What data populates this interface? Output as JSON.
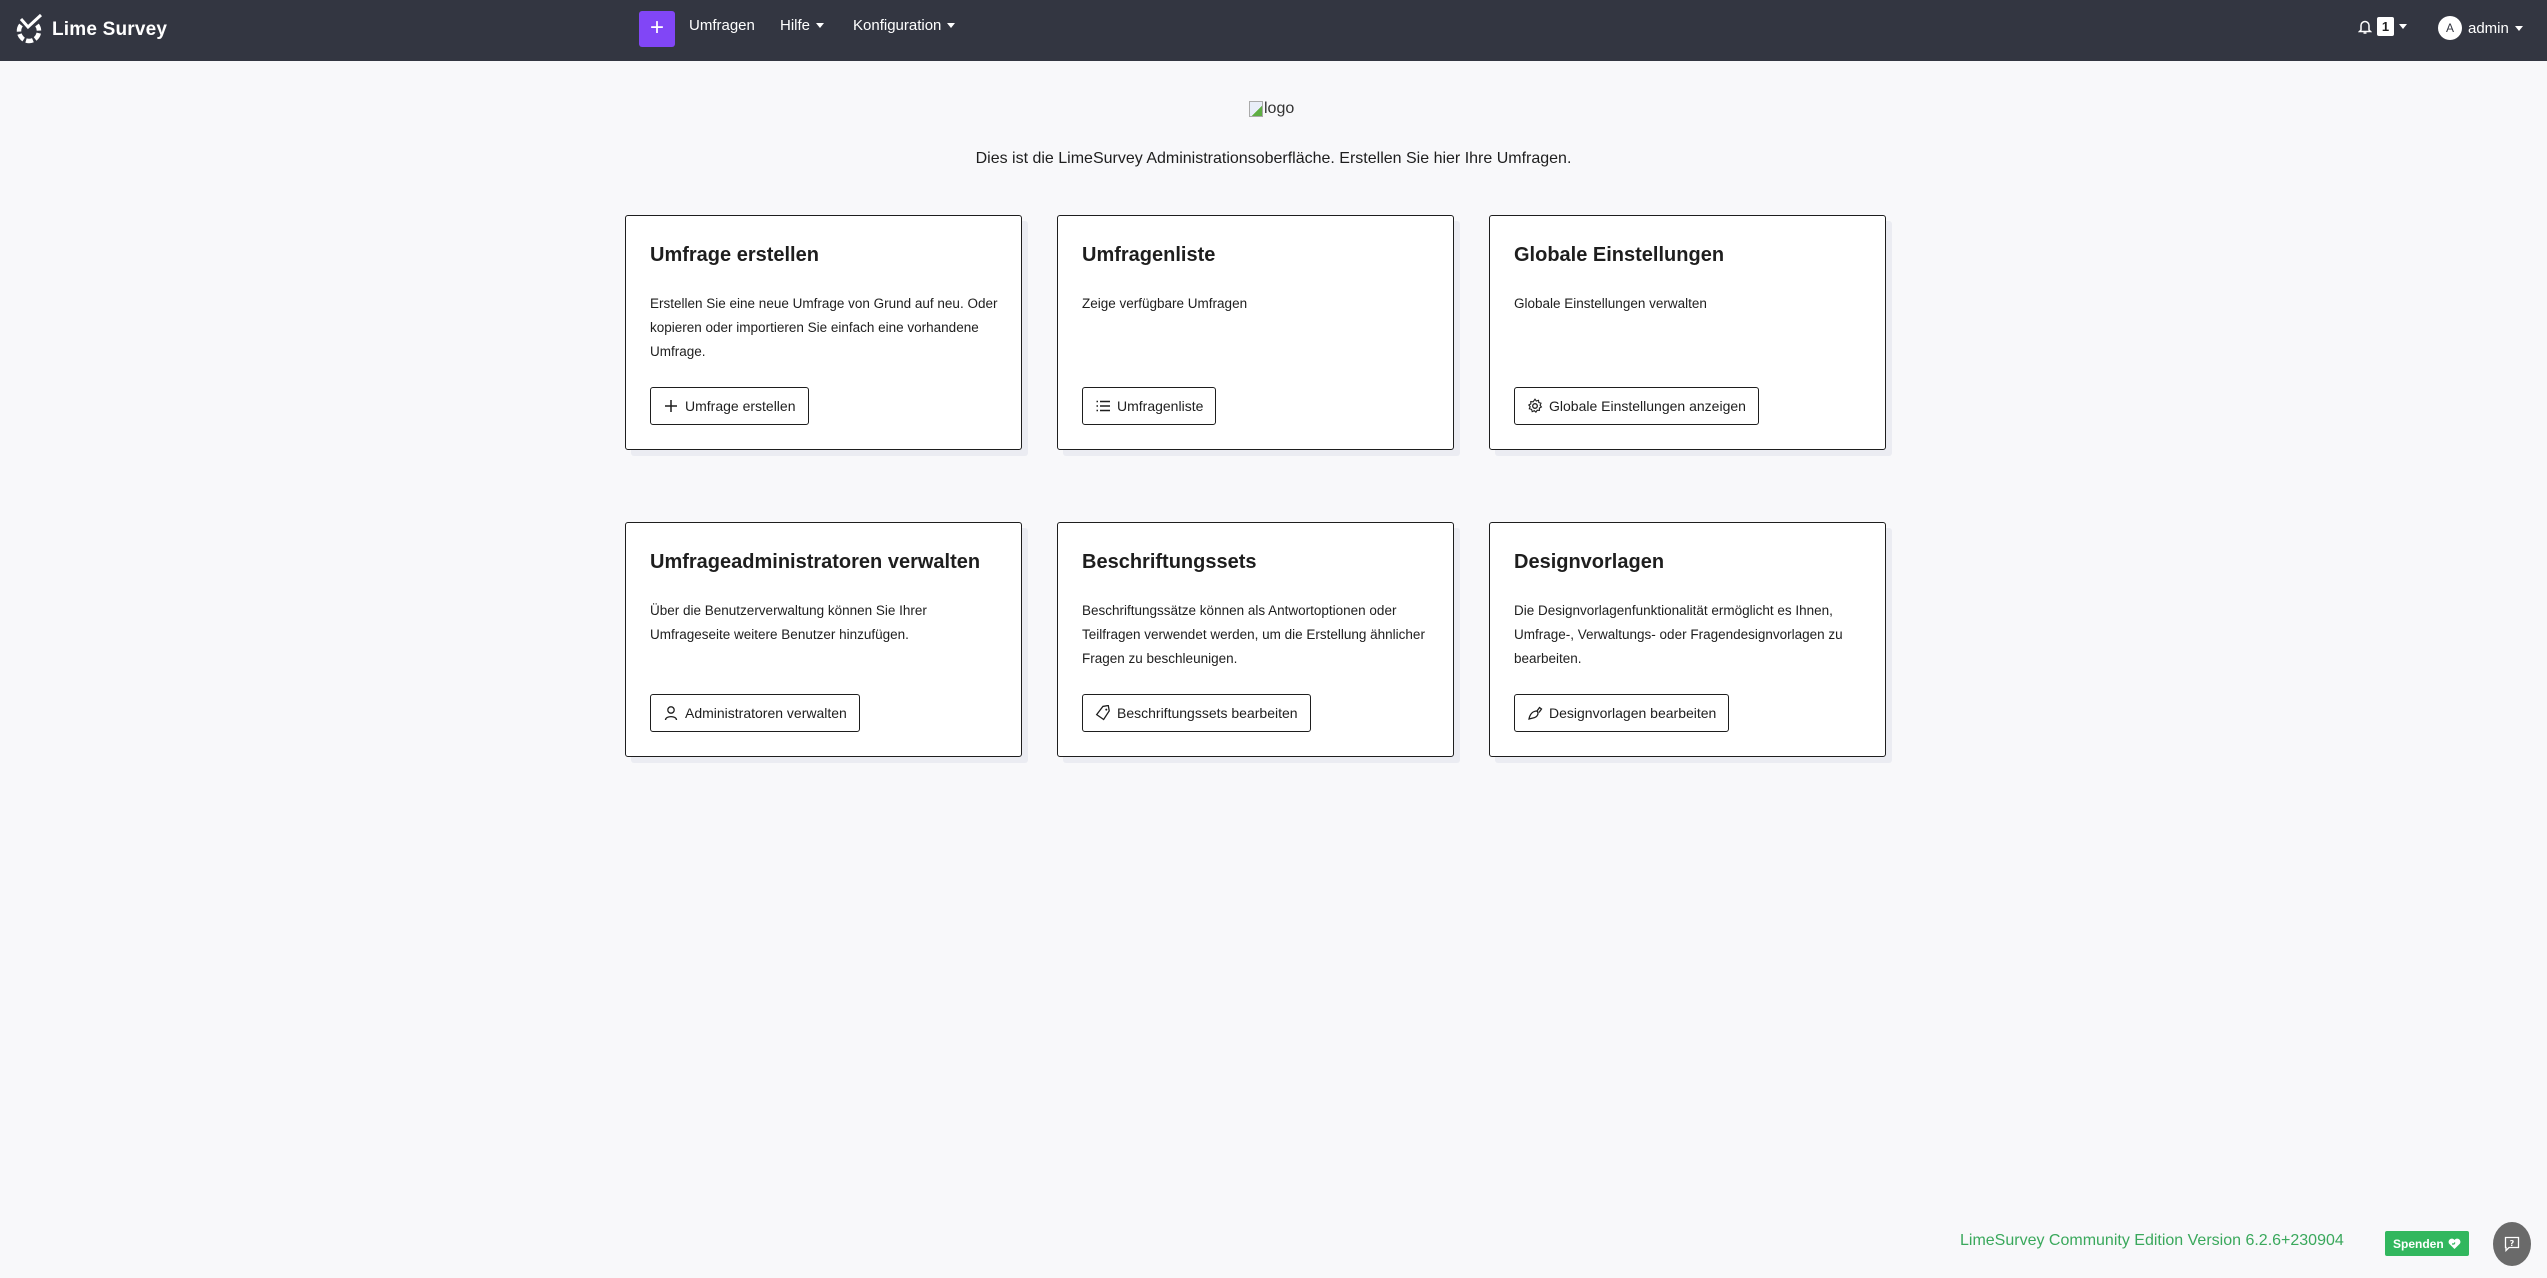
{
  "navbar": {
    "brand": "Lime Survey",
    "plus_label": "+",
    "items": [
      {
        "label": "Umfragen",
        "has_caret": false
      },
      {
        "label": "Hilfe",
        "has_caret": true
      },
      {
        "label": "Konfiguration",
        "has_caret": true
      }
    ],
    "notification_count": "1",
    "user": {
      "avatar_letter": "A",
      "name": "admin"
    }
  },
  "hero": {
    "logo_alt": "logo",
    "intro": "Dies ist die LimeSurvey Administrationsoberfläche. Erstellen Sie hier Ihre Umfragen."
  },
  "cards": [
    {
      "title": "Umfrage erstellen",
      "description": "Erstellen Sie eine neue Umfrage von Grund auf neu. Oder kopieren oder importieren Sie einfach eine vorhandene Umfrage.",
      "button_label": "Umfrage erstellen",
      "icon": "plus-icon"
    },
    {
      "title": "Umfragenliste",
      "description": "Zeige verfügbare Umfragen",
      "button_label": "Umfragenliste",
      "icon": "list-icon"
    },
    {
      "title": "Globale Einstellungen",
      "description": "Globale Einstellungen verwalten",
      "button_label": "Globale Einstellungen anzeigen",
      "icon": "gear-icon"
    },
    {
      "title": "Umfrageadministratoren verwalten",
      "description": "Über die Benutzerverwaltung können Sie Ihrer Umfrageseite weitere Benutzer hinzufügen.",
      "button_label": "Administratoren verwalten",
      "icon": "user-icon"
    },
    {
      "title": "Beschriftungssets",
      "description": "Beschriftungssätze können als Antwortoptionen oder Teilfragen verwendet werden, um die Erstellung ähnlicher Fragen zu beschleunigen.",
      "button_label": "Beschriftungssets bearbeiten",
      "icon": "tag-icon"
    },
    {
      "title": "Designvorlagen",
      "description": "Die Designvorlagenfunktionalität ermöglicht es Ihnen, Umfrage-, Verwaltungs- oder Fragendesignvorlagen zu bearbeiten.",
      "button_label": "Designvorlagen bearbeiten",
      "icon": "brush-icon"
    }
  ],
  "footer": {
    "version": "LimeSurvey Community Edition Version 6.2.6+230904",
    "donate_label": "Spenden"
  },
  "colors": {
    "navbar_bg": "#333641",
    "accent_purple": "#8146f6",
    "success_green": "#32b75e",
    "version_green": "#3aa85c"
  }
}
